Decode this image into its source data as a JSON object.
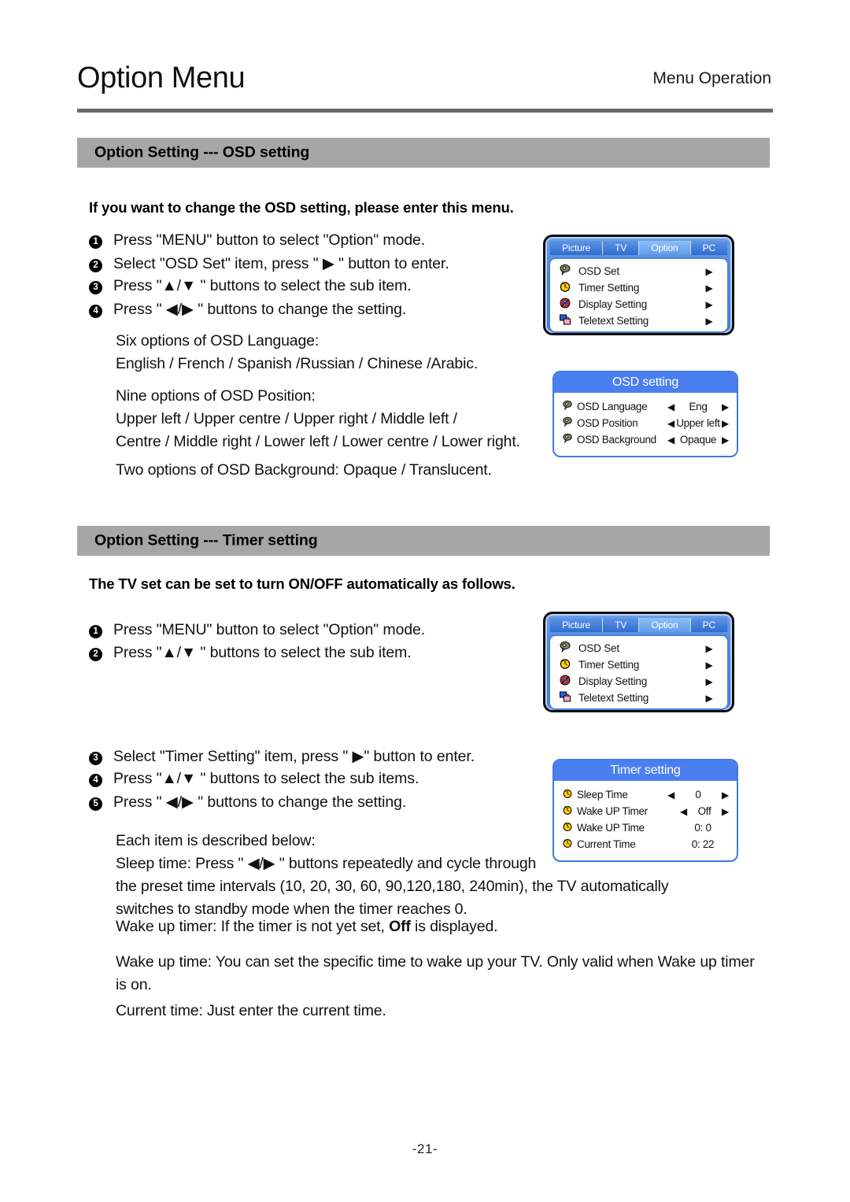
{
  "header": {
    "title": "Option Menu",
    "kicker": "Menu Operation"
  },
  "sections": {
    "osd": {
      "bar_label": "Option Setting --- OSD setting",
      "lead": "If you want to change the OSD setting, please enter this menu.",
      "steps": [
        {
          "num": "1",
          "text": "Press \"MENU\" button to select \"Option\" mode."
        },
        {
          "num": "2",
          "text": "Select \"OSD Set\" item, press \" ▶ \" button to enter."
        },
        {
          "num": "3",
          "text": "Press \"▲/▼ \" buttons to select the sub item."
        },
        {
          "num": "4",
          "text": "Press \" ◀/▶  \" buttons to change the setting."
        }
      ],
      "notes": "Six options of OSD Language:\nEnglish / French / Spanish /Russian / Chinese /Arabic.",
      "notes2": "Nine options of OSD Position:\nUpper left / Upper centre / Upper right / Middle left /\nCentre / Middle right / Lower left / Lower centre / Lower right.",
      "notes3": "Two options of OSD Background: Opaque / Translucent."
    },
    "timer": {
      "bar_label": "Option Setting --- Timer setting",
      "lead": "The TV set can be set to turn ON/OFF automatically as follows.",
      "steps_top": [
        {
          "num": "1",
          "text": "Press \"MENU\" button to select \"Option\" mode."
        },
        {
          "num": "2",
          "text": "Press \"▲/▼ \" buttons to select the sub item."
        }
      ],
      "steps_bottom": [
        {
          "num": "3",
          "text": "Select \"Timer Setting\" item, press \" ▶\" button to enter."
        },
        {
          "num": "4",
          "text": "Press \"▲/▼ \" buttons to select the sub items."
        },
        {
          "num": "5",
          "text": "Press \" ◀/▶ \" buttons to change the setting."
        }
      ],
      "desc_intro": "Each item is described below:\nSleep time: Press \" ◀/▶ \" buttons repeatedly and cycle through\nthe preset time intervals (10, 20, 30, 60, 90,120,180, 240min), the TV automatically\nswitches to standby mode when the timer reaches 0.",
      "desc_wake_timer_pre": "Wake up timer: If the timer is not yet set, ",
      "desc_wake_timer_bold": "Off",
      "desc_wake_timer_post": " is displayed.",
      "desc_wake_time": "Wake up time: You can set the specific time to wake up your TV. Only valid when Wake up timer\nis on.",
      "desc_current_time": "Current time: Just enter the current time."
    }
  },
  "tv_menu": {
    "tabs": [
      {
        "label": "Picture",
        "active": false
      },
      {
        "label": "TV",
        "active": false
      },
      {
        "label": "Option",
        "active": true
      },
      {
        "label": "PC",
        "active": false
      }
    ],
    "rows": [
      {
        "icon": "osd-set-icon",
        "label": "OSD Set",
        "arrow": "▶"
      },
      {
        "icon": "timer-setting-icon",
        "label": "Timer Setting",
        "arrow": "▶"
      },
      {
        "icon": "display-setting-icon",
        "label": "Display Setting",
        "arrow": "▶"
      },
      {
        "icon": "teletext-setting-icon",
        "label": "Teletext Setting",
        "arrow": "▶"
      }
    ]
  },
  "osd_setting_panel": {
    "title": "OSD setting",
    "rows": [
      {
        "icon": "osd-bubble-icon",
        "label": "OSD Language",
        "left_arrow": "◀",
        "value": "Eng",
        "right_arrow": "▶"
      },
      {
        "icon": "osd-bubble-icon",
        "label": "OSD Position",
        "left_arrow": "◀",
        "value": "Upper left",
        "right_arrow": "▶"
      },
      {
        "icon": "osd-bubble-icon",
        "label": "OSD Background",
        "left_arrow": "◀",
        "value": "Opaque",
        "right_arrow": "▶"
      }
    ]
  },
  "timer_setting_panel": {
    "title": "Timer setting",
    "rows": [
      {
        "icon": "clock-icon",
        "label": "Sleep Time",
        "left_arrow": "◀",
        "value": "0",
        "right_arrow": "▶",
        "has_arrows": true
      },
      {
        "icon": "clock-icon",
        "label": "Wake UP Timer",
        "left_arrow": "◀",
        "value": "Off",
        "right_arrow": "▶",
        "has_arrows": true
      },
      {
        "icon": "clock-icon",
        "label": "Wake UP Time",
        "value": "0: 0",
        "has_arrows": false
      },
      {
        "icon": "clock-icon",
        "label": "Current Time",
        "value": "0: 22",
        "has_arrows": false
      }
    ]
  },
  "footer": {
    "page_number": "-21-"
  },
  "colors": {
    "section_bar": "#a6a6a6",
    "rule": "#6a6a6a",
    "panel_title_blue": "#4a7ff0",
    "panel_border_blue": "#3f7ae0",
    "tab_active_blue": "#8fc0f6"
  }
}
